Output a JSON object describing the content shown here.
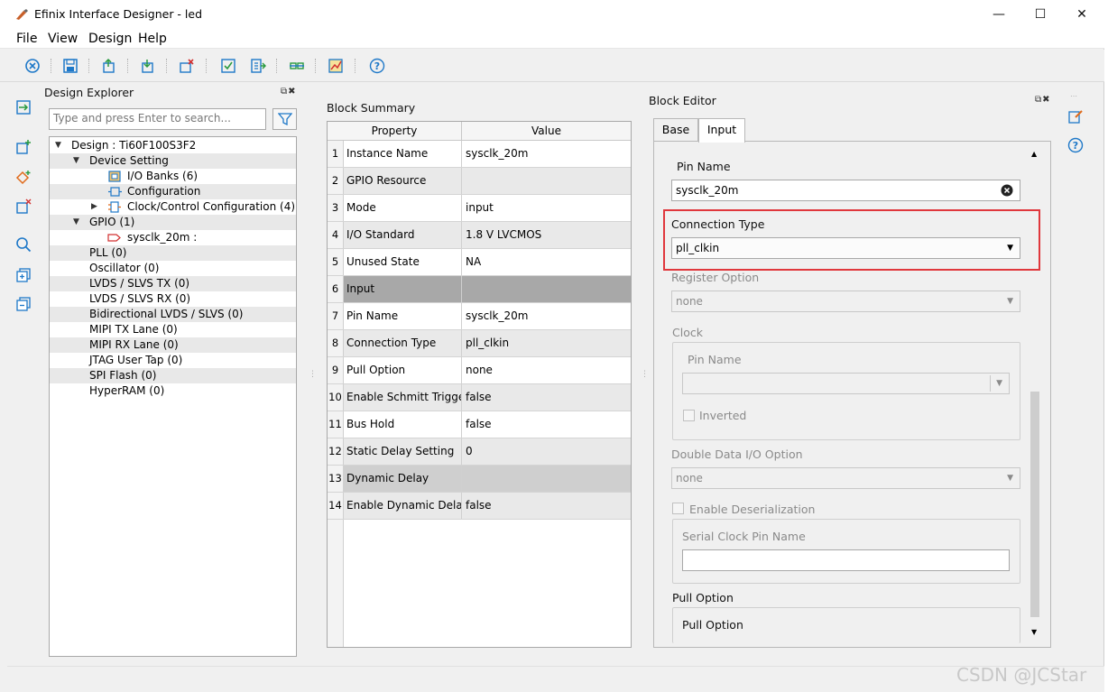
{
  "window": {
    "title": "Efinix Interface Designer - led",
    "minimize": "—",
    "maximize": "☐",
    "close": "✕"
  },
  "menu": [
    "File",
    "View",
    "Design",
    "Help"
  ],
  "design_explorer": {
    "title": "Design Explorer",
    "search_placeholder": "Type and press Enter to search...",
    "tree": [
      {
        "label": "Design : Ti60F100S3F2",
        "indent": 1,
        "arrow": "▼"
      },
      {
        "label": "Device Setting",
        "indent": 2,
        "arrow": "▼"
      },
      {
        "label": "I/O Banks (6)",
        "indent": 4,
        "icon": "io-banks-icon"
      },
      {
        "label": "Configuration",
        "indent": 4,
        "icon": "configuration-icon"
      },
      {
        "label": "Clock/Control Configuration (4)",
        "indent": 4,
        "arrow": "▶",
        "icon": "clock-control-icon"
      },
      {
        "label": "GPIO (1)",
        "indent": 2,
        "arrow": "▼"
      },
      {
        "label": "sysclk_20m :",
        "indent": 4,
        "icon": "gpio-pin-icon"
      },
      {
        "label": "PLL (0)",
        "indent": 2
      },
      {
        "label": "Oscillator (0)",
        "indent": 2
      },
      {
        "label": "LVDS / SLVS TX (0)",
        "indent": 2
      },
      {
        "label": "LVDS / SLVS RX (0)",
        "indent": 2
      },
      {
        "label": "Bidirectional LVDS / SLVS (0)",
        "indent": 2
      },
      {
        "label": "MIPI TX Lane (0)",
        "indent": 2
      },
      {
        "label": "MIPI RX Lane (0)",
        "indent": 2
      },
      {
        "label": "JTAG User Tap (0)",
        "indent": 2
      },
      {
        "label": "SPI Flash (0)",
        "indent": 2
      },
      {
        "label": "HyperRAM (0)",
        "indent": 2
      }
    ]
  },
  "block_summary": {
    "title": "Block Summary",
    "headers": [
      "Property",
      "Value"
    ],
    "rows": [
      {
        "n": "1",
        "property": "Instance Name",
        "value": "sysclk_20m",
        "style": ""
      },
      {
        "n": "2",
        "property": "GPIO Resource",
        "value": "",
        "style": "gray"
      },
      {
        "n": "3",
        "property": "Mode",
        "value": "input",
        "style": ""
      },
      {
        "n": "4",
        "property": "I/O Standard",
        "value": "1.8 V LVCMOS",
        "style": "gray"
      },
      {
        "n": "5",
        "property": "Unused State",
        "value": "NA",
        "style": ""
      },
      {
        "n": "6",
        "property": "Input",
        "value": "",
        "style": "dark"
      },
      {
        "n": "7",
        "property": "Pin Name",
        "value": "sysclk_20m",
        "style": ""
      },
      {
        "n": "8",
        "property": "Connection Type",
        "value": "pll_clkin",
        "style": "gray"
      },
      {
        "n": "9",
        "property": "Pull Option",
        "value": "none",
        "style": ""
      },
      {
        "n": "10",
        "property": "Enable Schmitt Trigger",
        "value": "false",
        "style": "gray"
      },
      {
        "n": "11",
        "property": "Bus Hold",
        "value": "false",
        "style": ""
      },
      {
        "n": "12",
        "property": "Static Delay Setting",
        "value": "0",
        "style": "gray"
      },
      {
        "n": "13",
        "property": "Dynamic Delay",
        "value": "",
        "style": "mid"
      },
      {
        "n": "14",
        "property": "Enable Dynamic Delay",
        "value": "false",
        "style": "gray"
      }
    ]
  },
  "block_editor": {
    "title": "Block Editor",
    "tabs": [
      "Base",
      "Input"
    ],
    "active_tab": "Input",
    "pin_name_label": "Pin Name",
    "pin_name_value": "sysclk_20m",
    "connection_type_label": "Connection Type",
    "connection_type_value": "pll_clkin",
    "register_option_label": "Register Option",
    "register_option_value": "none",
    "clock_label": "Clock",
    "clock_pin_name_label": "Pin Name",
    "inverted_label": "Inverted",
    "double_data_label": "Double Data I/O Option",
    "double_data_value": "none",
    "enable_deserialization_label": "Enable Deserialization",
    "serial_clock_pin_label": "Serial Clock Pin Name",
    "pull_option_group_label": "Pull Option",
    "pull_option_label": "Pull Option"
  },
  "watermark": "CSDN @JCStar",
  "colors": {
    "highlight": "#e0373c",
    "accent": "#1e78c8"
  }
}
